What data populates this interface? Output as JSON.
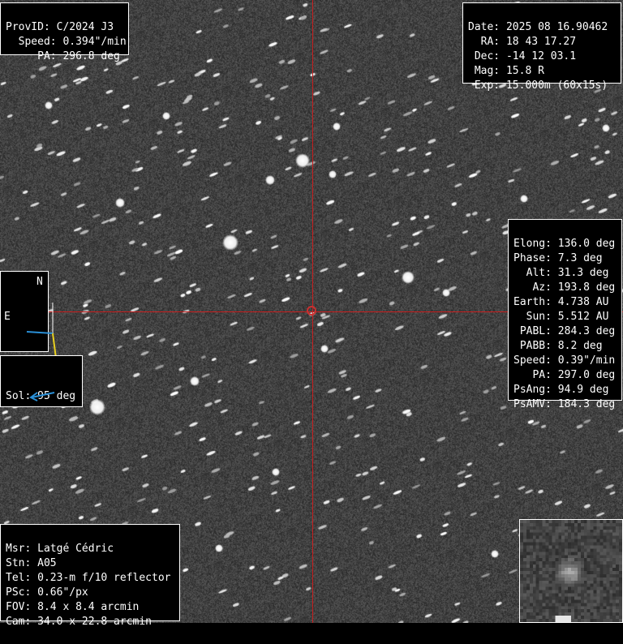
{
  "object_info": {
    "provid": "ProvID: C/2024 J3",
    "speed": "  Speed: 0.394\"/min",
    "pa": "     PA: 296.8 deg"
  },
  "observation": {
    "date": "Date: 2025 08 16.90462",
    "ra": "  RA: 18 43 17.27",
    "dec": " Dec: -14 12 03.1",
    "mag": " Mag: 15.8 R",
    "exp": " Exp: 15.000m (60x15s)"
  },
  "geometry": {
    "elong": "Elong: 136.0 deg",
    "phase": "Phase: 7.3 deg",
    "alt": "  Alt: 31.3 deg",
    "az": "   Az: 193.8 deg",
    "earth": "Earth: 4.738 AU",
    "sun": "  Sun: 5.512 AU",
    "pabl": " PABL: 284.3 deg",
    "pabb": " PABB: 8.2 deg",
    "speed": "Speed: 0.39\"/min",
    "pa": "   PA: 297.0 deg",
    "psang": "PsAng: 94.9 deg",
    "psamv": "PsAMV: 184.3 deg"
  },
  "compass": {
    "north_label": "N",
    "east_label": "E"
  },
  "sol": {
    "label": "Sol: 95 deg",
    "arrow_color": "#2a8fd6"
  },
  "station": {
    "msr": "Msr: Latgé Cédric",
    "stn": "Stn: A05",
    "tel": "Tel: 0.23-m f/10 reflector",
    "psc": "PSc: 0.66\"/px",
    "fov": "FOV: 8.4 x 8.4 arcmin",
    "cam": "Cam: 34.0 x 22.8 arcmin"
  },
  "colors": {
    "crosshair": "#c81e1e",
    "compass_north": "#e8d020",
    "compass_east": "#2a8fd6"
  }
}
